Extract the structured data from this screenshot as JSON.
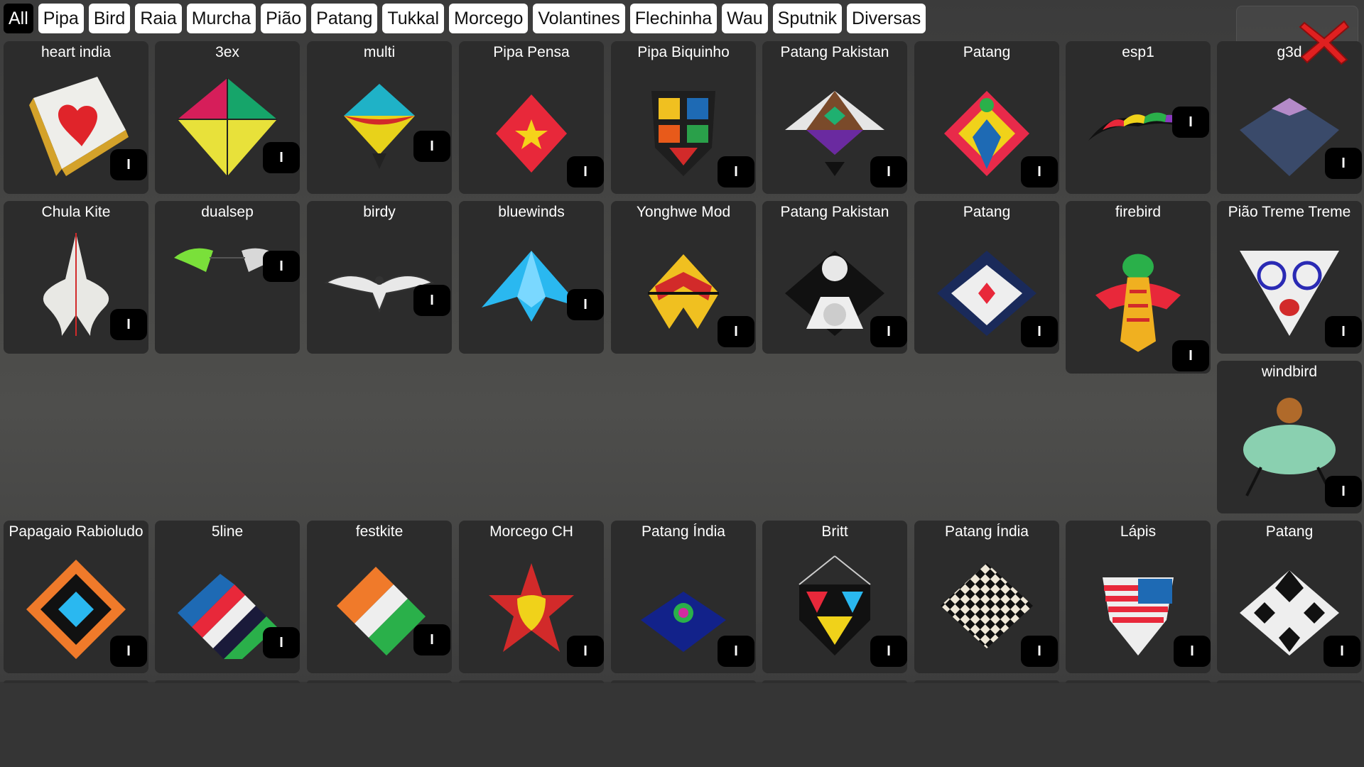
{
  "filters": [
    "All",
    "Pipa",
    "Bird",
    "Raia",
    "Murcha",
    "Pião",
    "Patang",
    "Tukkal",
    "Morcego",
    "Volantines",
    "Flechinha",
    "Wau",
    "Sputnik",
    "Diversas"
  ],
  "active_filter": "All",
  "close_icon": "close-icon",
  "colors": {
    "background": "#3a3a3a",
    "card_background": "#2c2c2c",
    "chip_background": "#ffffff",
    "chip_active_background": "#000000",
    "info_button_background": "#000000",
    "close_icon": "#e02020"
  },
  "info_label": "I",
  "kites": [
    {
      "name": "heart india",
      "art": "heart-india-kite-icon"
    },
    {
      "name": "3ex",
      "art": "diamond-kite-icon"
    },
    {
      "name": "multi",
      "art": "multi-kite-icon"
    },
    {
      "name": "Pipa Pensa",
      "art": "star-diamond-kite-icon"
    },
    {
      "name": "Pipa Biquinho",
      "art": "shield-kite-icon"
    },
    {
      "name": "Patang Pakistan",
      "art": "patang-kite-icon"
    },
    {
      "name": "Patang",
      "art": "patang-kite-icon"
    },
    {
      "name": "esp1",
      "art": "stunt-kite-icon"
    },
    {
      "name": "g3d",
      "art": "dotted-diamond-kite-icon"
    },
    {
      "name": "Chula Kite",
      "art": "chula-kite-icon"
    },
    {
      "name": "dualsep",
      "art": "dual-wing-kite-icon"
    },
    {
      "name": "birdy",
      "art": "bird-kite-icon"
    },
    {
      "name": "bluewinds",
      "art": "blue-delta-kite-icon"
    },
    {
      "name": "Yonghwe Mod",
      "art": "yonghwe-kite-icon"
    },
    {
      "name": "Patang Pakistan",
      "art": "mandala-kite-icon"
    },
    {
      "name": "Patang",
      "art": "blue-patang-kite-icon"
    },
    {
      "name": "firebird",
      "art": "firebird-kite-icon"
    },
    {
      "name": "Pião Treme Treme",
      "art": "face-kite-icon"
    },
    {
      "name": "windbird",
      "art": "windbird-kite-icon"
    },
    {
      "name": "Papagaio Rabioludo",
      "art": "flower-kite-icon"
    },
    {
      "name": "5line",
      "art": "striped-kite-icon"
    },
    {
      "name": "festkite",
      "art": "tricolor-kite-icon"
    },
    {
      "name": "Morcego CH",
      "art": "ch-star-kite-icon"
    },
    {
      "name": "Patang Índia",
      "art": "peacock-kite-icon"
    },
    {
      "name": "Britt",
      "art": "stained-glass-kite-icon"
    },
    {
      "name": "Patang Índia",
      "art": "checkered-kite-icon"
    },
    {
      "name": "Lápis",
      "art": "flag-kite-icon"
    },
    {
      "name": "Patang",
      "art": "black-white-kite-icon"
    }
  ]
}
